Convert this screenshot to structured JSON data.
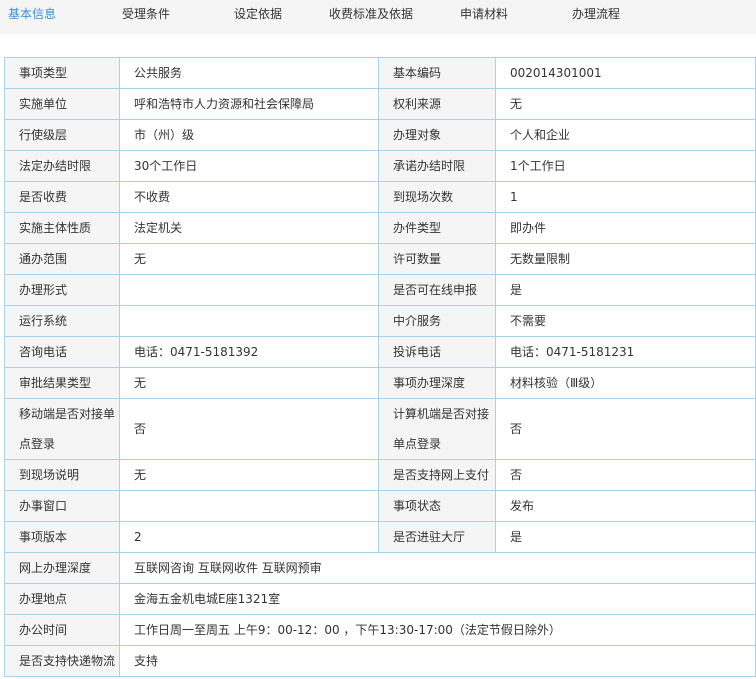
{
  "tabs": [
    "基本信息",
    "受理条件",
    "设定依据",
    "收费标准及依据",
    "申请材料",
    "办理流程"
  ],
  "active_tab": "基本信息",
  "accent_color": "#3b8fd9",
  "rows": [
    [
      [
        "事项类型",
        "公共服务"
      ],
      [
        "基本编码",
        "002014301001"
      ]
    ],
    [
      [
        "实施单位",
        "呼和浩特市人力资源和社会保障局"
      ],
      [
        "权利来源",
        "无"
      ]
    ],
    [
      [
        "行使级层",
        "市（州）级"
      ],
      [
        "办理对象",
        "个人和企业"
      ]
    ],
    [
      [
        "法定办结时限",
        "30个工作日"
      ],
      [
        "承诺办结时限",
        "1个工作日"
      ]
    ],
    [
      [
        "是否收费",
        "不收费"
      ],
      [
        "到现场次数",
        "1"
      ]
    ],
    [
      [
        "实施主体性质",
        "法定机关"
      ],
      [
        "办件类型",
        "即办件"
      ]
    ],
    [
      [
        "通办范围",
        "无"
      ],
      [
        "许可数量",
        "无数量限制"
      ]
    ],
    [
      [
        "办理形式",
        ""
      ],
      [
        "是否可在线申报",
        "是"
      ]
    ],
    [
      [
        "运行系统",
        ""
      ],
      [
        "中介服务",
        "不需要"
      ]
    ],
    [
      [
        "咨询电话",
        "电话：0471-5181392"
      ],
      [
        "投诉电话",
        "电话：0471-5181231"
      ]
    ],
    [
      [
        "审批结果类型",
        "无"
      ],
      [
        "事项办理深度",
        "材料核验（Ⅲ级）"
      ]
    ],
    [
      [
        "移动端是否对接单点登录",
        "否"
      ],
      [
        "计算机端是否对接单点登录",
        "否"
      ]
    ],
    [
      [
        "到现场说明",
        "无"
      ],
      [
        "是否支持网上支付",
        "否"
      ]
    ],
    [
      [
        "办事窗口",
        ""
      ],
      [
        "事项状态",
        "发布"
      ]
    ],
    [
      [
        "事项版本",
        "2"
      ],
      [
        "是否进驻大厅",
        "是"
      ]
    ]
  ],
  "full_rows": [
    [
      "网上办理深度",
      "互联网咨询 互联网收件 互联网预审"
    ],
    [
      "办理地点",
      "金海五金机电城E座1321室"
    ],
    [
      "办公时间",
      "工作日周一至周五 上午9：00-12：00 ，下午13:30-17:00（法定节假日除外）"
    ],
    [
      "是否支持快递物流",
      "支持"
    ]
  ]
}
